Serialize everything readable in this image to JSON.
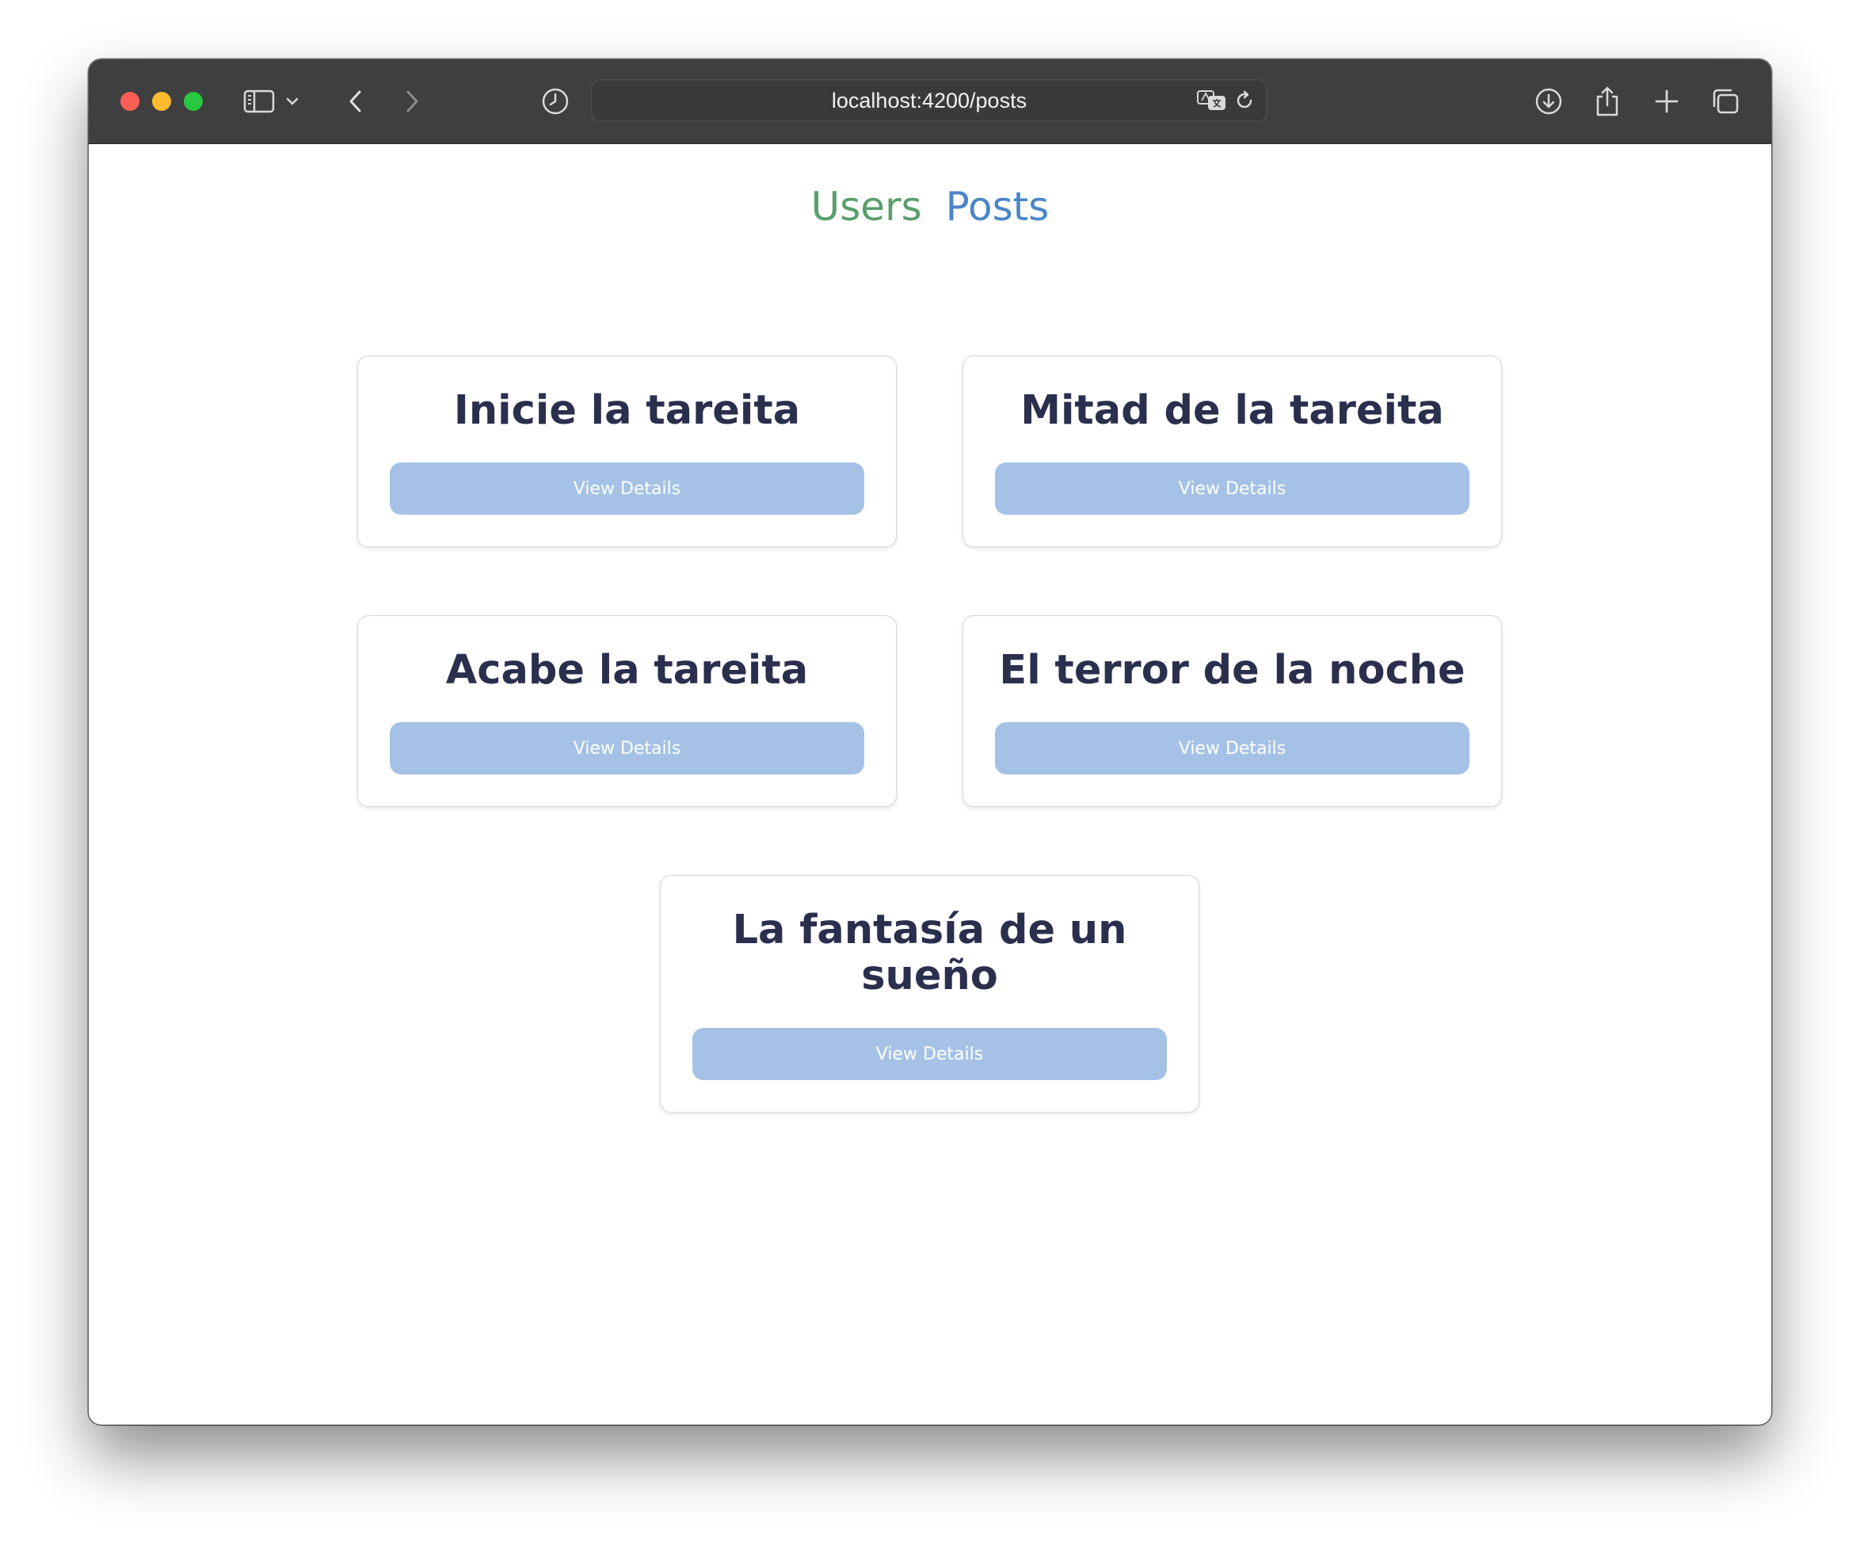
{
  "browser": {
    "url": "localhost:4200/posts"
  },
  "nav": {
    "users_label": "Users",
    "posts_label": "Posts"
  },
  "posts": [
    {
      "title": "Inicie la tareita",
      "button_label": "View Details"
    },
    {
      "title": "Mitad de la tareita",
      "button_label": "View Details"
    },
    {
      "title": "Acabe la tareita",
      "button_label": "View Details"
    },
    {
      "title": "El terror de la noche",
      "button_label": "View Details"
    },
    {
      "title": "La fantasía de un sueño",
      "button_label": "View Details"
    }
  ],
  "colors": {
    "toolbar": "#3f3f3f",
    "nav_users": "#5a9e6b",
    "nav_posts": "#4a86c8",
    "card_title": "#2b2f4e",
    "button_bg": "#a5c2e6"
  }
}
